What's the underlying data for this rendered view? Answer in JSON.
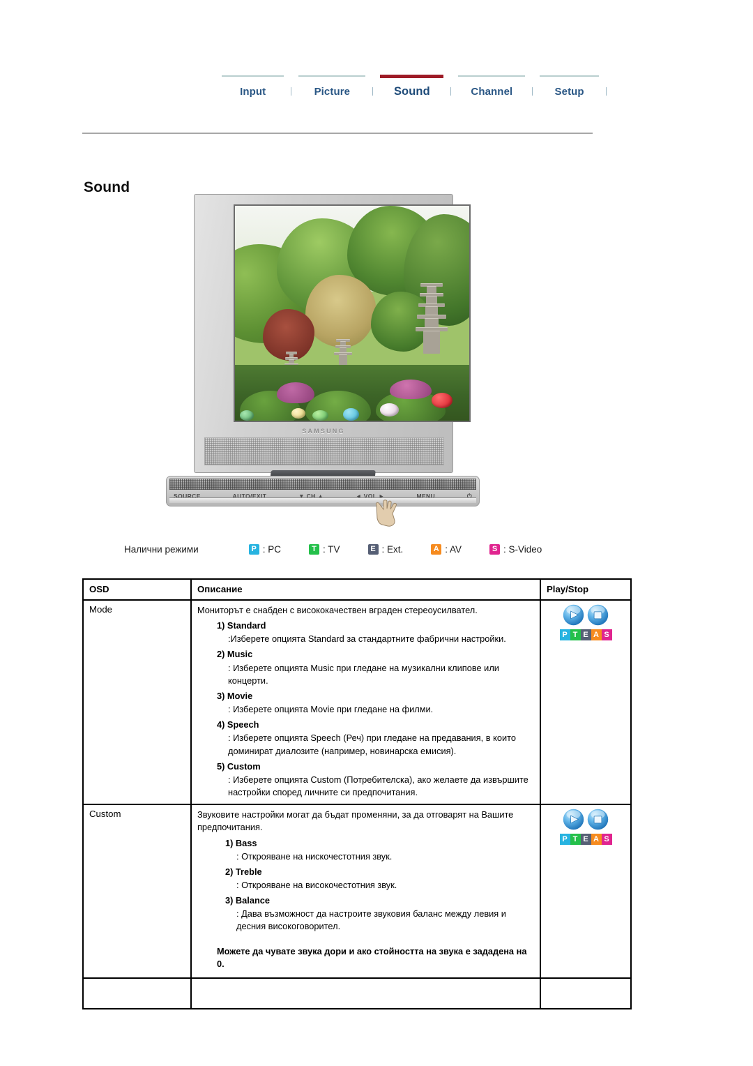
{
  "nav": {
    "items": [
      {
        "label": "Input",
        "active": false
      },
      {
        "label": "Picture",
        "active": false
      },
      {
        "label": "Sound",
        "active": true
      },
      {
        "label": "Channel",
        "active": false
      },
      {
        "label": "Setup",
        "active": false
      }
    ]
  },
  "page": {
    "title": "Sound"
  },
  "monitor": {
    "brand": "SAMSUNG",
    "controls": [
      "SOURCE",
      "AUTO/EXIT",
      "▼ CH ▲",
      "◄ VOL ►",
      "MENU",
      "⏻"
    ]
  },
  "legend": {
    "label": "Налични режими",
    "items": [
      {
        "letter": "P",
        "text": ": PC",
        "color": "#27b3e0"
      },
      {
        "letter": "T",
        "text": ": TV",
        "color": "#24c04a"
      },
      {
        "letter": "E",
        "text": ": Ext.",
        "color": "#565f75"
      },
      {
        "letter": "A",
        "text": ": AV",
        "color": "#f68b1f"
      },
      {
        "letter": "S",
        "text": ": S-Video",
        "color": "#e0248f"
      }
    ]
  },
  "table": {
    "headers": {
      "osd": "OSD",
      "description": "Описание",
      "playstop": "Play/Stop"
    },
    "rows": [
      {
        "osd": "Mode",
        "intro": "Мониторът е снабден с висококачествен вграден стереоусилвател.",
        "options": [
          {
            "title": "1) Standard",
            "body": ":Изберете опцията Standard за стандартните фабрични настройки."
          },
          {
            "title": "2) Music",
            "body": ": Изберете опцията Music при гледане на музикални клипове или концерти."
          },
          {
            "title": "3) Movie",
            "body": ": Изберете опцията Movie при гледане на филми."
          },
          {
            "title": "4) Speech",
            "body": ": Изберете опцията Speech (Реч) при гледане на предавания, в които доминират диалозите (например, новинарска емисия)."
          },
          {
            "title": "5) Custom",
            "body": ": Изберете опцията Custom (Потребителска), ако желаете да извършите настройки според личните си предпочитания."
          }
        ],
        "note": "",
        "playstop": true
      },
      {
        "osd": "Custom",
        "intro": "Звуковите настройки могат да бъдат променяни, за да отговарят на Вашите предпочитания.",
        "options": [
          {
            "title": "1) Bass",
            "body": ": Открояване на нискочестотния звук."
          },
          {
            "title": "2) Treble",
            "body": ": Открояване на високочестотния звук."
          },
          {
            "title": "3) Balance",
            "body": ": Дава възможност да настроите звуковия баланс между левия и десния високоговорител."
          }
        ],
        "note": "Можете да чувате звука дори и ако стойността на звука е зададена на 0.",
        "playstop": true
      }
    ],
    "pteas": [
      {
        "letter": "P",
        "color": "#27b3e0"
      },
      {
        "letter": "T",
        "color": "#24c04a"
      },
      {
        "letter": "E",
        "color": "#565f75"
      },
      {
        "letter": "A",
        "color": "#f68b1f"
      },
      {
        "letter": "S",
        "color": "#e0248f"
      }
    ],
    "icons": {
      "play": "play-icon",
      "stop": "stop-icon"
    }
  },
  "colors": {
    "active_tab_underline": "#9e1b26",
    "nav_link": "#2a5785",
    "rule": "#b9cfcf"
  }
}
